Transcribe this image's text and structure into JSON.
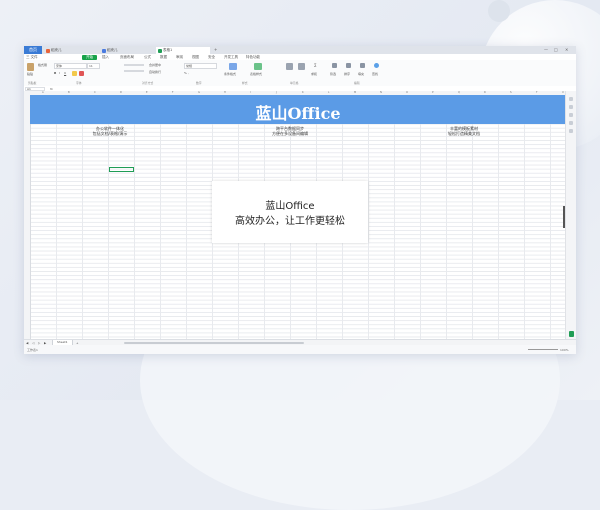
{
  "app": {
    "home_tab": "首页",
    "tabs": [
      {
        "label": "稻壳儿",
        "color": "#e8643a"
      },
      {
        "label": "稻壳儿",
        "color": "#4a7be0"
      },
      {
        "label": "表格1",
        "color": "#1f9d55"
      }
    ],
    "new_tab": "+",
    "login": "登录"
  },
  "menu": {
    "file": "三 文件",
    "items": [
      "开始",
      "插入",
      "页面布局",
      "公式",
      "数据",
      "审阅",
      "视图",
      "安全",
      "开发工具",
      "特色功能"
    ],
    "active_index": 0
  },
  "ribbon": {
    "groups": [
      "剪贴板",
      "字体",
      "对齐方式",
      "数字",
      "样式",
      "单元格",
      "编辑"
    ],
    "font_name": "宋体",
    "font_size": "11",
    "labels": [
      "粘贴",
      "格式刷",
      "合并居中",
      "自动换行",
      "常规",
      "条件格式",
      "表格样式",
      "求和",
      "筛选",
      "排序",
      "填充",
      "查找"
    ]
  },
  "formula_bar": {
    "name_box": "A1",
    "fx": "fx"
  },
  "columns": [
    "A",
    "B",
    "C",
    "D",
    "E",
    "F",
    "G",
    "H",
    "I",
    "J",
    "K",
    "L",
    "M",
    "N",
    "O",
    "P",
    "Q",
    "R",
    "S",
    "T",
    "U"
  ],
  "banner": {
    "title": "蓝山Office",
    "color": "#5b9be6"
  },
  "features": [
    {
      "line1": "办公软件一体化",
      "line2": "包括文档/表格/演示"
    },
    {
      "line1": "跨平台数据同步",
      "line2": "方便在多设备间编辑"
    },
    {
      "line1": "丰富的模板素材",
      "line2": "轻松打造精美文档"
    }
  ],
  "popup": {
    "line1": "蓝山Office",
    "line2": "高效办公，让工作更轻松"
  },
  "sheet_tabs": {
    "active": "Sheet1",
    "add": "+"
  },
  "status": {
    "left": "工作表1",
    "zoom": "100%"
  },
  "colors": {
    "accent": "#1f9d55",
    "tabbar": "#3a7bd5"
  }
}
